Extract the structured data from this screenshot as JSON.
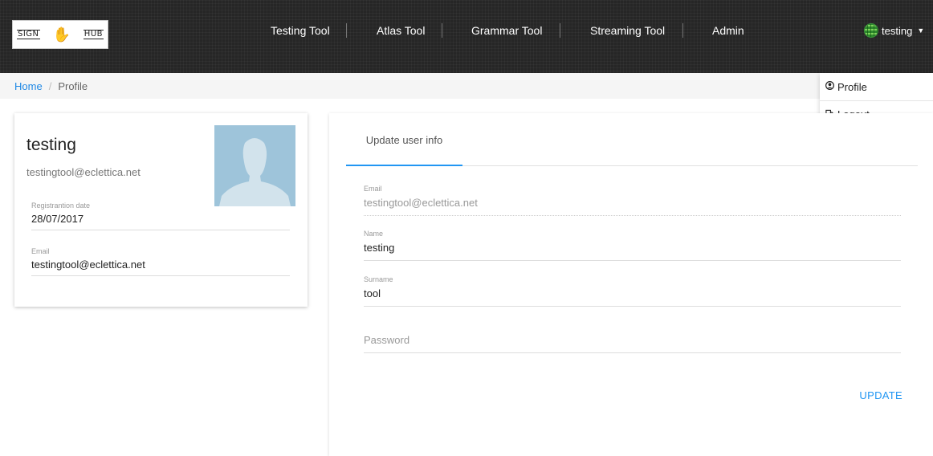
{
  "header": {
    "logo": {
      "text_left": "SIGN",
      "text_right": "HUB",
      "icon": "hands-icon"
    },
    "nav": [
      {
        "label": "Testing Tool"
      },
      {
        "label": "Atlas Tool"
      },
      {
        "label": "Grammar Tool"
      },
      {
        "label": "Streaming Tool"
      },
      {
        "label": "Admin"
      }
    ],
    "user": {
      "name": "testing",
      "icon": "globe-icon"
    }
  },
  "breadcrumb": {
    "home": "Home",
    "separator": "/",
    "current": "Profile"
  },
  "user_dropdown": {
    "items": [
      {
        "label": "Profile",
        "icon": "user-circle-icon"
      },
      {
        "label": "Logout",
        "icon": "logout-icon"
      }
    ]
  },
  "profile_card": {
    "name": "testing",
    "email": "testingtool@eclettica.net",
    "registration_label": "Registrantion date",
    "registration_value": "28/07/2017",
    "email_label": "Email",
    "email_value": "testingtool@eclettica.net"
  },
  "form": {
    "tab_label": "Update user info",
    "email_label": "Email",
    "email_value": "testingtool@eclettica.net",
    "name_label": "Name",
    "name_value": "testing",
    "surname_label": "Surname",
    "surname_value": "tool",
    "password_placeholder": "Password",
    "submit_label": "UPDATE"
  },
  "colors": {
    "header_bg": "#262626",
    "accent": "#2196f3",
    "breadcrumb_bg": "#f5f5f5",
    "avatar_bg": "#9ec4da"
  }
}
